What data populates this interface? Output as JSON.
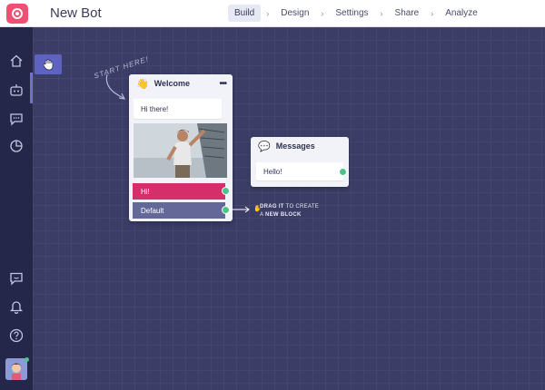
{
  "app": {
    "title": "New Bot"
  },
  "nav": {
    "tabs": [
      {
        "label": "Build",
        "active": true
      },
      {
        "label": "Design",
        "active": false
      },
      {
        "label": "Settings",
        "active": false
      },
      {
        "label": "Share",
        "active": false
      },
      {
        "label": "Analyze",
        "active": false
      }
    ],
    "separator": "›"
  },
  "sidebar": {
    "items": [
      {
        "icon": "home-icon"
      },
      {
        "icon": "bot-icon",
        "active": true
      },
      {
        "icon": "chat-icon"
      },
      {
        "icon": "analytics-pie-icon"
      },
      {
        "icon": "feedback-icon"
      },
      {
        "icon": "bell-icon"
      },
      {
        "icon": "help-icon"
      }
    ],
    "status_color": "#4cc38a"
  },
  "canvas": {
    "start_label": "START HERE!",
    "welcome_block": {
      "emoji": "👋",
      "title": "Welcome",
      "menu": "•••",
      "message": "Hi there!",
      "quick_replies": [
        {
          "label": "Hi!",
          "color": "#d52f6b"
        },
        {
          "label": "Default",
          "color": "#636899"
        }
      ]
    },
    "messages_block": {
      "emoji": "💬",
      "title": "Messages",
      "message": "Hello!"
    },
    "drag_hint": {
      "strong1": "DRAG IT",
      "text1": " TO CREATE",
      "text2": "A ",
      "strong2": "NEW BLOCK"
    }
  },
  "colors": {
    "canvas_bg": "#3b3d66",
    "sidebar_bg": "#24264a",
    "brand": "#ef4f73",
    "port": "#4cc38a"
  }
}
